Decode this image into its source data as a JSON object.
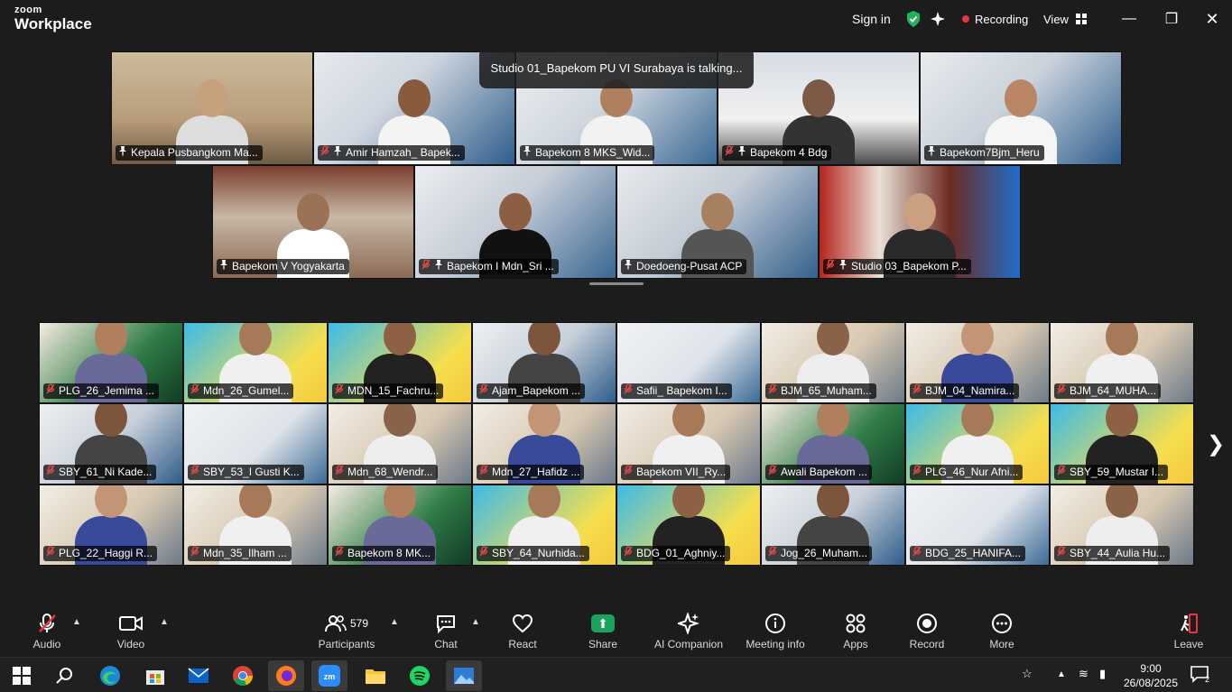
{
  "app": {
    "logo_top": "zoom",
    "logo_bottom": "Workplace"
  },
  "header": {
    "sign_in": "Sign in",
    "recording": "Recording",
    "view": "View"
  },
  "talking_banner": "Studio 01_Bapekom PU VI Surabaya is talking...",
  "top_tiles": [
    {
      "name": "Kepala Pusbangkom Ma...",
      "muted": false,
      "pinned": true
    },
    {
      "name": "Amir Hamzah_ Bapek...",
      "muted": true,
      "pinned": true
    },
    {
      "name": "Bapekom 8 MKS_Wid...",
      "muted": false,
      "pinned": true
    },
    {
      "name": "Bapekom 4 Bdg",
      "muted": true,
      "pinned": true
    },
    {
      "name": "Bapekom7Bjm_Heru",
      "muted": false,
      "pinned": true
    },
    {
      "name": "Bapekom V Yogyakarta",
      "muted": false,
      "pinned": true
    },
    {
      "name": "Bapekom I Mdn_Sri ...",
      "muted": true,
      "pinned": true
    },
    {
      "name": "Doedoeng-Pusat ACP",
      "muted": false,
      "pinned": true
    },
    {
      "name": "Studio 03_Bapekom P...",
      "muted": true,
      "pinned": true
    }
  ],
  "gallery_tiles": [
    {
      "name": "PLG_26_Jemima ..."
    },
    {
      "name": "Mdn_26_Gumel..."
    },
    {
      "name": "MDN_15_Fachru..."
    },
    {
      "name": "Ajam_Bapekom ..."
    },
    {
      "name": "Safii_ Bapekom I..."
    },
    {
      "name": "BJM_65_Muham..."
    },
    {
      "name": "BJM_04_Namira..."
    },
    {
      "name": "BJM_64_MUHA..."
    },
    {
      "name": "SBY_61_Ni Kade..."
    },
    {
      "name": "SBY_53_I Gusti K..."
    },
    {
      "name": "Mdn_68_Wendr..."
    },
    {
      "name": "Mdn_27_Hafidz ..."
    },
    {
      "name": "Bapekom VII_Ry..."
    },
    {
      "name": "Awali Bapekom ..."
    },
    {
      "name": "PLG_46_Nur Afni..."
    },
    {
      "name": "SBY_59_Mustar I..."
    },
    {
      "name": "PLG_22_Haggi R..."
    },
    {
      "name": "Mdn_35_Ilham ..."
    },
    {
      "name": "Bapekom 8 MK..."
    },
    {
      "name": "SBY_64_Nurhida..."
    },
    {
      "name": "BDG_01_Aghniy..."
    },
    {
      "name": "Jog_26_Muham..."
    },
    {
      "name": "BDG_25_HANIFA..."
    },
    {
      "name": "SBY_44_Aulia Hu..."
    }
  ],
  "toolbar": {
    "audio": "Audio",
    "video": "Video",
    "participants": "Participants",
    "participants_count": "579",
    "chat": "Chat",
    "react": "React",
    "share": "Share",
    "ai_companion": "AI Companion",
    "meeting_info": "Meeting info",
    "apps": "Apps",
    "record": "Record",
    "more": "More",
    "leave": "Leave"
  },
  "taskbar": {
    "time": "9:00",
    "date": "26/08/2025",
    "notifications": "2"
  },
  "colors": {
    "background": "#1c1c1c",
    "share_green": "#1aa35a",
    "recording_red": "#e8363c",
    "muted_red": "#e84a4a"
  }
}
